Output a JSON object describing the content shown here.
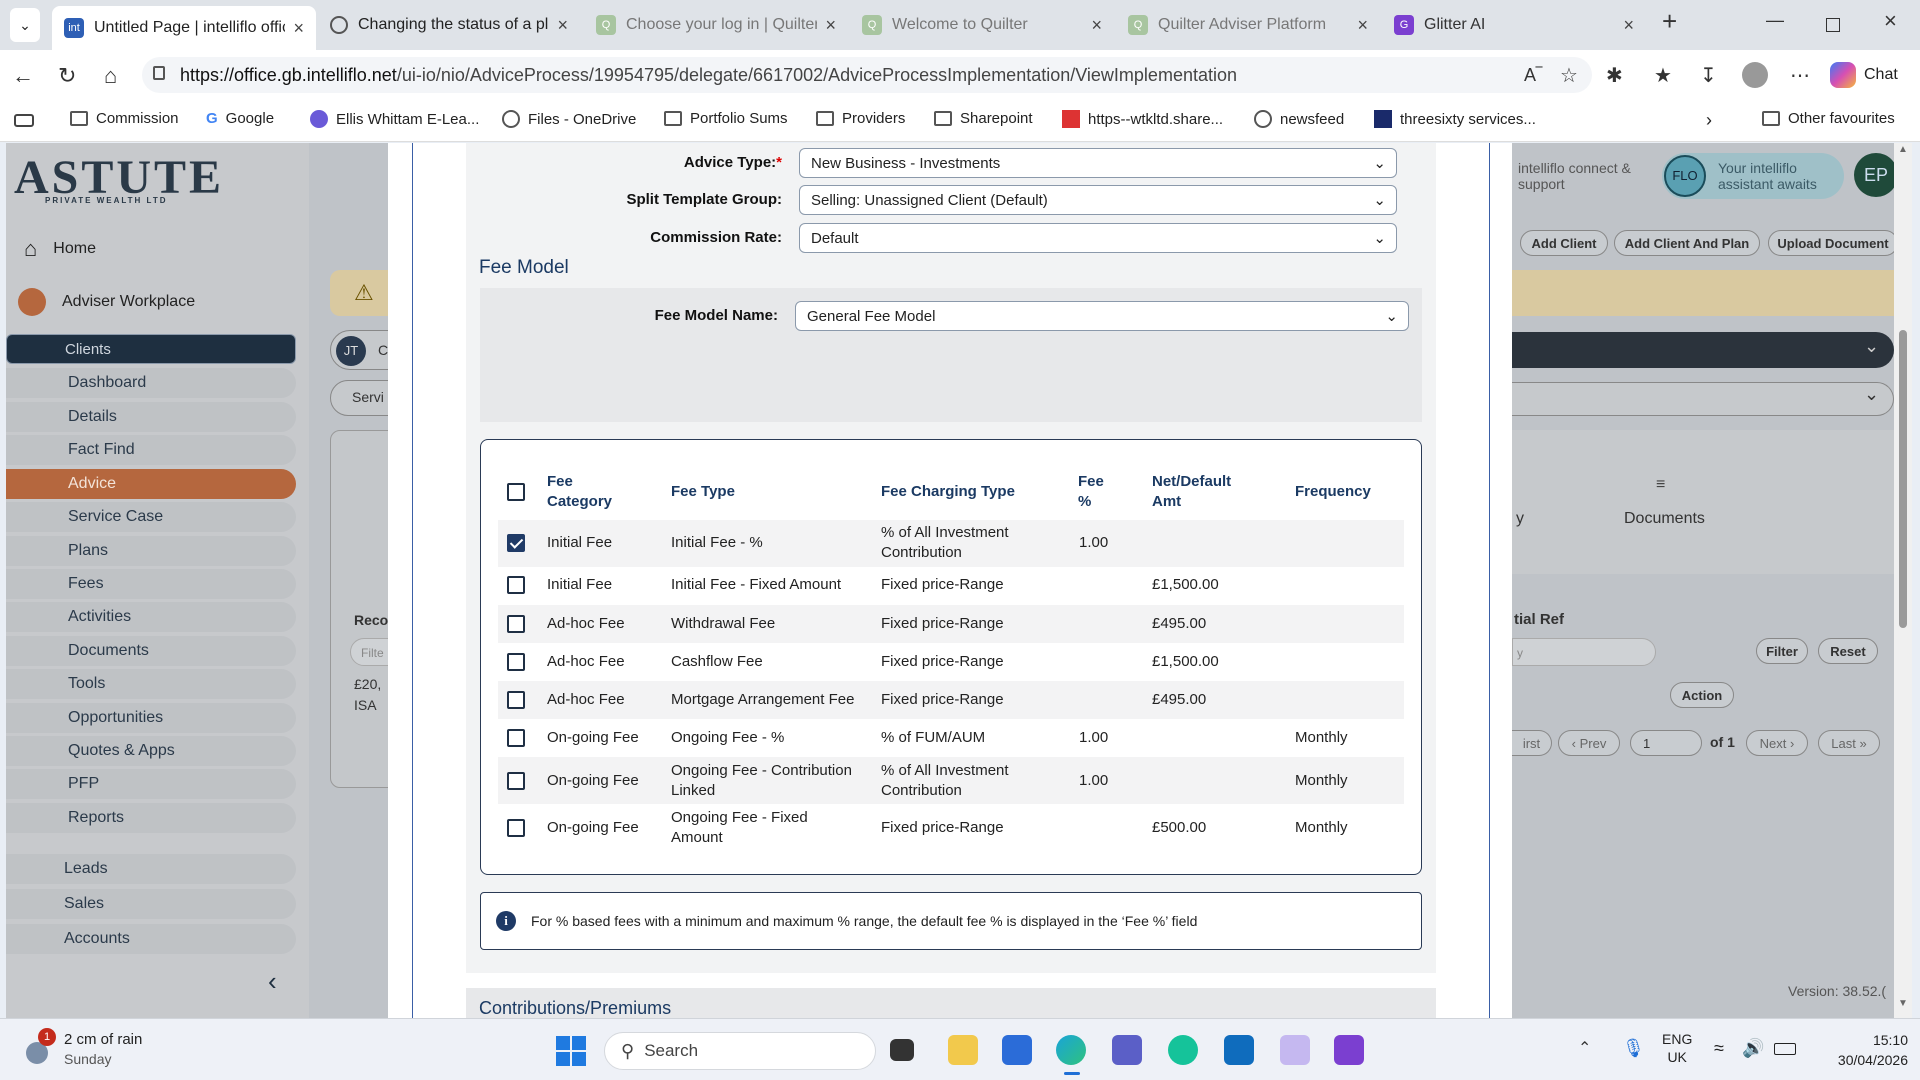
{
  "browser": {
    "tabs": [
      {
        "label": "Untitled Page | intelliflo office",
        "active": true
      },
      {
        "label": "Changing the status of a plan"
      },
      {
        "label": "Choose your log in | Quilter"
      },
      {
        "label": "Welcome to Quilter"
      },
      {
        "label": "Quilter Adviser Platform"
      },
      {
        "label": "Glitter AI"
      }
    ],
    "url_domain": "https://office.gb.intelliflo.net",
    "url_path": "/ui-io/nio/AdviceProcess/19954795/delegate/6617002/AdviceProcessImplementation/ViewImplementation",
    "chat_label": "Chat",
    "bookmarks": [
      "Commission",
      "Google",
      "Ellis Whittam E-Lea...",
      "Files - OneDrive",
      "Portfolio Sums",
      "Providers",
      "Sharepoint",
      "https--wtkltd.share...",
      "newsfeed",
      "threesixty services..."
    ],
    "other_favourites": "Other favourites"
  },
  "app": {
    "logo": "ASTUTE",
    "logo_sub": "PRIVATE WEALTH LTD",
    "home": "Home",
    "adviser_workplace": "Adviser Workplace",
    "nav": [
      "Clients",
      "Dashboard",
      "Details",
      "Fact Find",
      "Advice",
      "Service Case",
      "Plans",
      "Fees",
      "Activities",
      "Documents",
      "Tools",
      "Opportunities",
      "Quotes & Apps",
      "PFP",
      "Reports"
    ],
    "nav2": [
      "Leads",
      "Sales",
      "Accounts"
    ],
    "header": {
      "connect": "intelliflo connect & support",
      "flo_badge": "FLO",
      "flo_text": "Your intelliflo assistant awaits",
      "avatar": "EP",
      "buttons": [
        "Add Client",
        "Add Client And Plan",
        "Upload Document"
      ]
    },
    "client_initials": "JT",
    "client_initial_cut": "C",
    "service_cut": "Servi",
    "documents_tab": "Documents",
    "tab_cut": "y",
    "reco_cut": "Reco",
    "filter_cut": "Filte",
    "amount_cut": "£20,",
    "isa_cut": "ISA",
    "initial_ref": "tial Ref",
    "filter_placeholder": "y",
    "filter_btn": "Filter",
    "reset_btn": "Reset",
    "action_btn": "Action",
    "pager": {
      "first": "irst",
      "prev": "‹ Prev",
      "page": "1",
      "of": "of 1",
      "next": "Next ›",
      "last": "Last »"
    },
    "version": "Version: 38.52.("
  },
  "form": {
    "advice_type_label": "Advice Type:",
    "advice_type_value": "New Business - Investments",
    "split_label": "Split Template Group:",
    "split_value": "Selling: Unassigned Client (Default)",
    "commission_label": "Commission Rate:",
    "commission_value": "Default",
    "fee_model_heading": "Fee Model",
    "fee_model_name_label": "Fee Model Name:",
    "fee_model_name_value": "General Fee Model",
    "table": {
      "headers": {
        "category": "Fee Category",
        "type": "Fee Type",
        "charging": "Fee Charging Type",
        "pct": "Fee %",
        "net": "Net/Default Amt",
        "frequency": "Frequency"
      },
      "rows": [
        {
          "checked": true,
          "category": "Initial Fee",
          "type": "Initial Fee - %",
          "charging": "% of All Investment Contribution",
          "pct": "1.00",
          "net": "",
          "frequency": ""
        },
        {
          "checked": false,
          "category": "Initial Fee",
          "type": "Initial Fee - Fixed Amount",
          "charging": "Fixed price-Range",
          "pct": "",
          "net": "£1,500.00",
          "frequency": ""
        },
        {
          "checked": false,
          "category": "Ad-hoc Fee",
          "type": "Withdrawal Fee",
          "charging": "Fixed price-Range",
          "pct": "",
          "net": "£495.00",
          "frequency": ""
        },
        {
          "checked": false,
          "category": "Ad-hoc Fee",
          "type": "Cashflow Fee",
          "charging": "Fixed price-Range",
          "pct": "",
          "net": "£1,500.00",
          "frequency": ""
        },
        {
          "checked": false,
          "category": "Ad-hoc Fee",
          "type": "Mortgage Arrangement Fee",
          "charging": "Fixed price-Range",
          "pct": "",
          "net": "£495.00",
          "frequency": ""
        },
        {
          "checked": false,
          "category": "On-going Fee",
          "type": "Ongoing Fee - %",
          "charging": "% of FUM/AUM",
          "pct": "1.00",
          "net": "",
          "frequency": "Monthly"
        },
        {
          "checked": false,
          "category": "On-going Fee",
          "type": "Ongoing Fee - Contribution Linked",
          "charging": "% of All Investment Contribution",
          "pct": "1.00",
          "net": "",
          "frequency": "Monthly"
        },
        {
          "checked": false,
          "category": "On-going Fee",
          "type": "Ongoing Fee - Fixed Amount",
          "charging": "Fixed price-Range",
          "pct": "",
          "net": "£500.00",
          "frequency": "Monthly"
        }
      ]
    },
    "info_text": "For % based fees with a minimum and maximum % range, the default fee % is displayed in the ‘Fee %’ field",
    "contributions_heading": "Contributions/Premiums"
  },
  "taskbar": {
    "weather_badge": "1",
    "weather_title": "2 cm of rain",
    "weather_sub": "Sunday",
    "search": "Search",
    "lang1": "ENG",
    "lang2": "UK",
    "time": "15:10",
    "date": "30/04/2026"
  }
}
